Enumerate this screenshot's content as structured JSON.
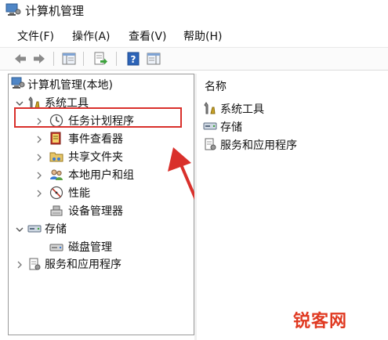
{
  "window": {
    "title": "计算机管理"
  },
  "menu": [
    {
      "label": "文件(F)"
    },
    {
      "label": "操作(A)"
    },
    {
      "label": "查看(V)"
    },
    {
      "label": "帮助(H)"
    }
  ],
  "toolbar": {
    "buttons": [
      "back-arrow-icon",
      "forward-arrow-icon",
      "show-tree-icon",
      "export-list-icon",
      "help-icon",
      "properties-icon"
    ]
  },
  "tree": {
    "root": "计算机管理(本地)",
    "system_tools": "系统工具",
    "task_scheduler": "任务计划程序",
    "event_viewer": "事件查看器",
    "shared_folders": "共享文件夹",
    "local_users": "本地用户和组",
    "performance": "性能",
    "device_manager": "设备管理器",
    "storage": "存储",
    "disk_management": "磁盘管理",
    "services_apps": "服务和应用程序"
  },
  "list": {
    "header": "名称",
    "items": [
      "系统工具",
      "存储",
      "服务和应用程序"
    ]
  },
  "watermark": "锐客网",
  "colors": {
    "annotation_red": "#d9302b",
    "watermark_red": "#e03a22"
  }
}
